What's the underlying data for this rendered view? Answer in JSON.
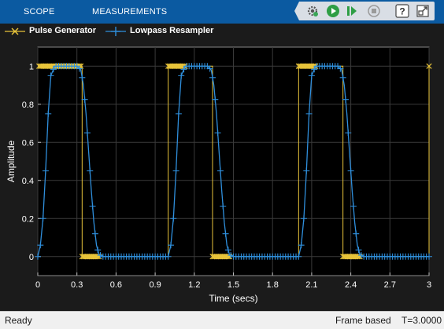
{
  "toolstrip": {
    "tabs": [
      {
        "label": "SCOPE"
      },
      {
        "label": "MEASUREMENTS"
      }
    ],
    "quick_access": [
      {
        "icon": "settings-gear-icon"
      },
      {
        "icon": "run-icon"
      },
      {
        "icon": "step-forward-icon"
      },
      {
        "icon": "stop-icon"
      },
      {
        "icon": "help-icon"
      },
      {
        "icon": "undock-icon"
      }
    ]
  },
  "legend": [
    {
      "label": "Pulse Generator",
      "marker": "x",
      "color": "#e8c43a"
    },
    {
      "label": "Lowpass Resampler",
      "marker": "+",
      "color": "#2f8fdc"
    }
  ],
  "chart_data": {
    "type": "line",
    "xlabel": "Time (secs)",
    "ylabel": "Amplitude",
    "xlim": [
      0,
      3
    ],
    "ylim": [
      -0.1,
      1.1
    ],
    "xticks": [
      0,
      0.3,
      0.6,
      0.9,
      1.2,
      1.5,
      1.8,
      2.1,
      2.4,
      2.7,
      3
    ],
    "xtick_labels": [
      "0",
      "0.3",
      "0.6",
      "0.9",
      "1.2",
      "1.5",
      "1.8",
      "2.1",
      "2.4",
      "2.7",
      "3"
    ],
    "yticks": [
      0,
      0.2,
      0.4,
      0.6,
      0.8,
      1
    ],
    "ytick_labels": [
      "0",
      "0.2",
      "0.4",
      "0.6",
      "0.8",
      "1"
    ],
    "grid": true,
    "background": "#000000",
    "series": [
      {
        "name": "Pulse Generator",
        "color": "#e8c43a",
        "marker": "x",
        "step": true,
        "x": [
          0,
          0.34,
          0.34,
          1.0,
          1.0,
          1.34,
          1.34,
          2.0,
          2.0,
          2.34,
          2.34,
          3.0,
          3.0
        ],
        "y": [
          1,
          1,
          0,
          0,
          1,
          1,
          0,
          0,
          1,
          1,
          0,
          0,
          1
        ],
        "marker_runs": [
          {
            "x0": 0.01,
            "x1": 0.33,
            "y": 1
          },
          {
            "x0": 0.34,
            "x1": 0.47,
            "y": 0
          },
          {
            "x0": 1.0,
            "x1": 1.13,
            "y": 1
          },
          {
            "x0": 1.34,
            "x1": 1.47,
            "y": 0
          },
          {
            "x0": 2.0,
            "x1": 2.13,
            "y": 1
          },
          {
            "x0": 2.34,
            "x1": 2.47,
            "y": 0
          }
        ],
        "extra_markers": [
          {
            "x": 3.0,
            "y": 1
          }
        ]
      },
      {
        "name": "Lowpass Resampler",
        "color": "#2f8fdc",
        "marker": "+",
        "x": [
          0,
          0.02,
          0.04,
          0.06,
          0.08,
          0.1,
          0.13,
          0.3,
          0.33,
          0.35,
          0.37,
          0.39,
          0.41,
          0.43,
          0.45,
          0.47,
          0.5,
          0.6,
          0.9,
          1.0,
          1.02,
          1.04,
          1.06,
          1.08,
          1.1,
          1.13,
          1.3,
          1.33,
          1.35,
          1.37,
          1.39,
          1.41,
          1.43,
          1.45,
          1.47,
          1.5,
          1.8,
          2.0,
          2.02,
          2.04,
          2.06,
          2.08,
          2.1,
          2.13,
          2.3,
          2.33,
          2.35,
          2.37,
          2.39,
          2.41,
          2.43,
          2.45,
          2.47,
          2.5,
          3.0
        ],
        "y": [
          0,
          0.06,
          0.2,
          0.45,
          0.75,
          0.95,
          1.0,
          1.0,
          0.98,
          0.9,
          0.75,
          0.55,
          0.35,
          0.18,
          0.06,
          0.01,
          0.0,
          0.0,
          0.0,
          0.0,
          0.06,
          0.2,
          0.45,
          0.75,
          0.95,
          1.0,
          1.0,
          0.98,
          0.9,
          0.75,
          0.55,
          0.35,
          0.18,
          0.06,
          0.01,
          0.0,
          0.0,
          0.0,
          0.06,
          0.2,
          0.45,
          0.75,
          0.95,
          1.0,
          1.0,
          0.98,
          0.9,
          0.75,
          0.55,
          0.35,
          0.18,
          0.06,
          0.01,
          0.0,
          0.0
        ],
        "marker_step": 0.02
      }
    ]
  },
  "status": {
    "ready": "Ready",
    "mode": "Frame based",
    "time": "T=3.0000"
  }
}
